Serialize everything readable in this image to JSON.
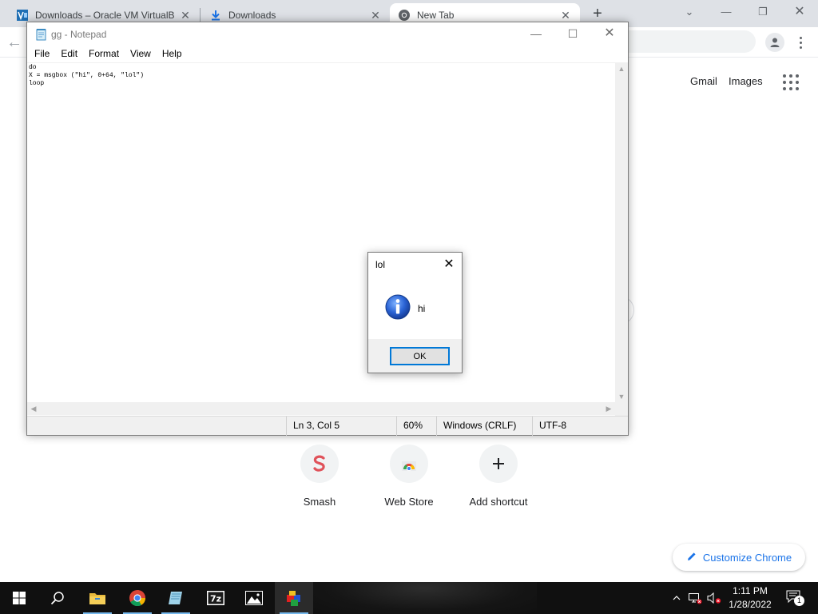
{
  "chrome": {
    "tabs": [
      {
        "title": "Downloads – Oracle VM VirtualB",
        "icon": "virtualbox-icon"
      },
      {
        "title": "Downloads",
        "icon": "download-icon"
      },
      {
        "title": "New Tab",
        "icon": "chrome-icon",
        "active": true
      }
    ],
    "top_links": {
      "gmail": "Gmail",
      "images": "Images"
    },
    "shortcuts": [
      {
        "label": "Smash",
        "icon": "smash-icon"
      },
      {
        "label": "Web Store",
        "icon": "web-store-icon"
      },
      {
        "label": "Add shortcut",
        "icon": "plus-icon"
      }
    ],
    "customize_label": "Customize Chrome"
  },
  "notepad": {
    "title": "gg - Notepad",
    "menu": [
      "File",
      "Edit",
      "Format",
      "View",
      "Help"
    ],
    "content": "do\nX = msgbox (\"hi\", 0+64, \"lol\")\nloop",
    "status": {
      "position": "Ln 3, Col 5",
      "zoom": "60%",
      "line_ending": "Windows (CRLF)",
      "encoding": "UTF-8"
    }
  },
  "msgbox": {
    "title": "lol",
    "message": "hi",
    "ok_label": "OK",
    "icon": "info-icon"
  },
  "taskbar": {
    "apps": [
      "file-explorer-icon",
      "chrome-icon",
      "notepad-icon",
      "7zip-icon",
      "photos-icon",
      "virtualbox-icon"
    ],
    "time": "1:11 PM",
    "date": "1/28/2022",
    "notification_count": "1"
  },
  "colors": {
    "accent_blue": "#1a73e8",
    "focus_border": "#0078d7",
    "taskbar": "#101010"
  }
}
